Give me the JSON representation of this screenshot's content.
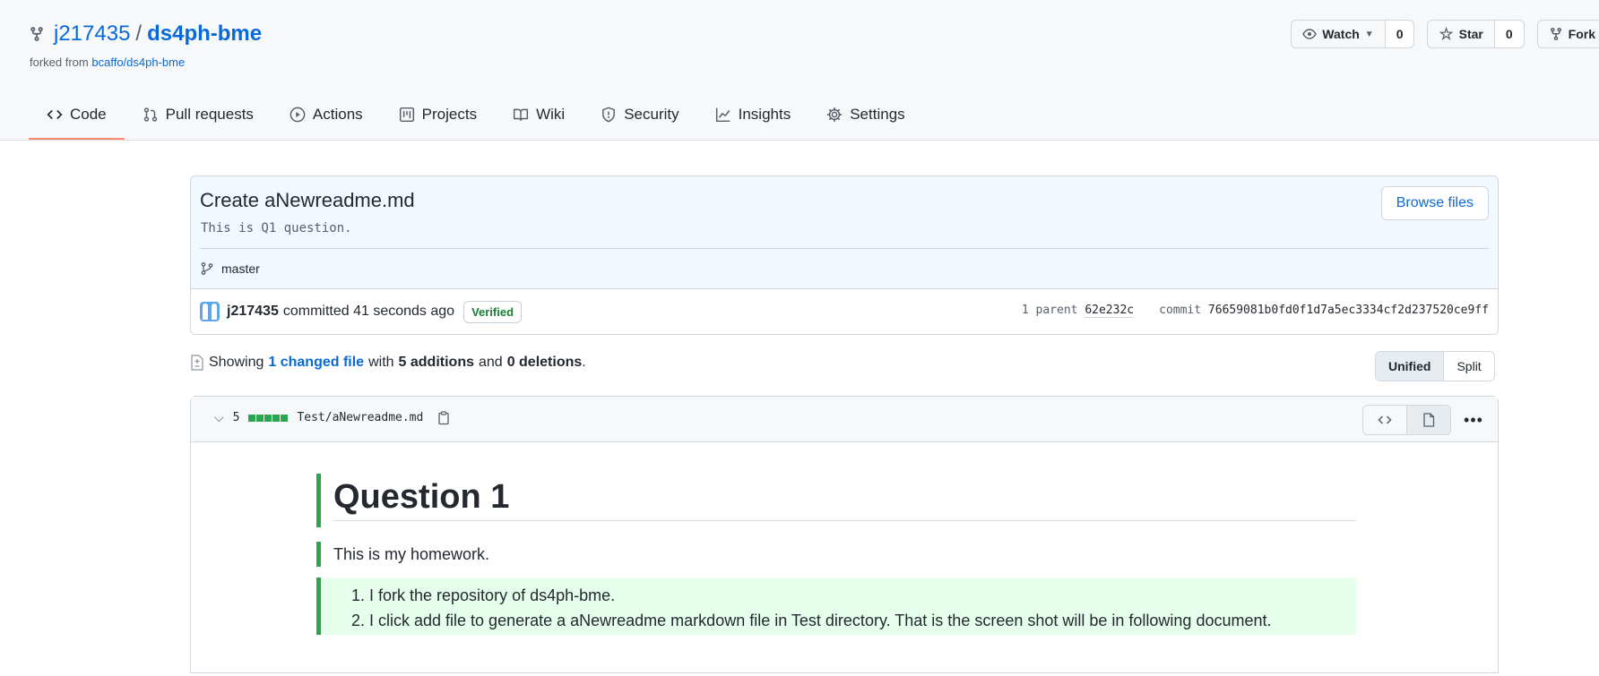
{
  "repo": {
    "owner": "j217435",
    "separator": "/",
    "name": "ds4ph-bme",
    "forked_prefix": "forked from",
    "forked_source": "bcaffo/ds4ph-bme"
  },
  "actions": {
    "watch_label": "Watch",
    "watch_count": "0",
    "star_label": "Star",
    "star_count": "0",
    "fork_label": "Fork"
  },
  "tabs": [
    {
      "label": "Code",
      "icon": "code-icon",
      "active": true
    },
    {
      "label": "Pull requests",
      "icon": "pull-request-icon"
    },
    {
      "label": "Actions",
      "icon": "play-icon"
    },
    {
      "label": "Projects",
      "icon": "project-icon"
    },
    {
      "label": "Wiki",
      "icon": "book-icon"
    },
    {
      "label": "Security",
      "icon": "shield-icon"
    },
    {
      "label": "Insights",
      "icon": "graph-icon"
    },
    {
      "label": "Settings",
      "icon": "gear-icon"
    }
  ],
  "commit": {
    "title": "Create aNewreadme.md",
    "description": "This is Q1 question.",
    "browse_label": "Browse files",
    "branch": "master",
    "author": "j217435",
    "committed_text": "committed 41 seconds ago",
    "verified_label": "Verified",
    "parent_label": "1 parent",
    "parent_sha": "62e232c",
    "commit_label": "commit",
    "commit_sha": "76659081b0fd0f1d7a5ec3334cf2d237520ce9ff"
  },
  "stats": {
    "showing": "Showing",
    "changed_files": "1 changed file",
    "with": "with",
    "additions": "5 additions",
    "and": "and",
    "deletions": "0 deletions",
    "period": "."
  },
  "view_toggle": {
    "unified": "Unified",
    "split": "Split",
    "selected": "Unified"
  },
  "file": {
    "change_count": "5",
    "path": "Test/aNewreadme.md",
    "heading": "Question 1",
    "paragraph": "This is my homework.",
    "list": [
      "I fork the repository of ds4ph-bme.",
      "I click add file to generate a aNewreadme markdown file in Test directory. That is the screen shot will be in following document."
    ]
  },
  "colors": {
    "link": "#0969da",
    "addition": "#2da44e",
    "added_bg": "#e6ffec",
    "verified": "#1a7f37",
    "tab_underline": "#fd8c73"
  }
}
